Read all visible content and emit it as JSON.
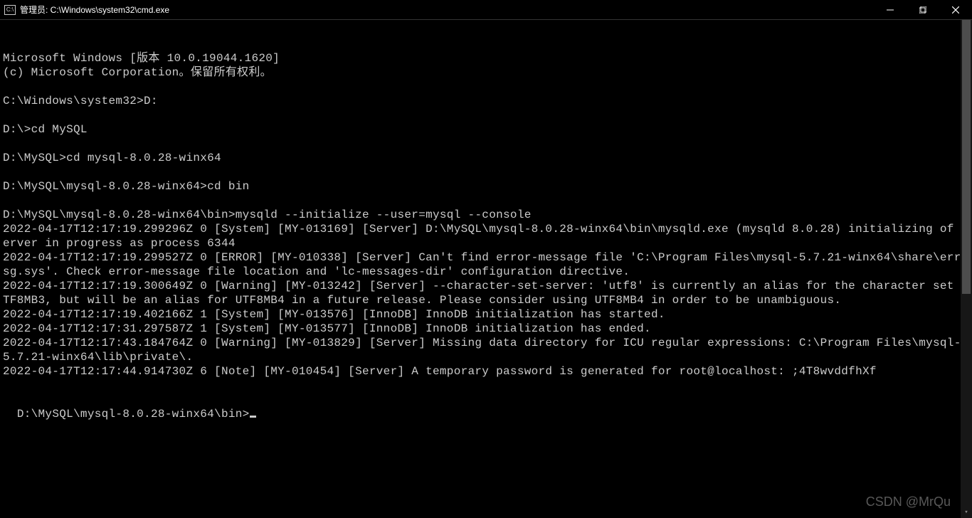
{
  "window": {
    "title": "管理员: C:\\Windows\\system32\\cmd.exe",
    "icon_label": "C:\\"
  },
  "terminal": {
    "lines": [
      "Microsoft Windows [版本 10.0.19044.1620]",
      "(c) Microsoft Corporation。保留所有权利。",
      "",
      "C:\\Windows\\system32>D:",
      "",
      "D:\\>cd MySQL",
      "",
      "D:\\MySQL>cd mysql-8.0.28-winx64",
      "",
      "D:\\MySQL\\mysql-8.0.28-winx64>cd bin",
      "",
      "D:\\MySQL\\mysql-8.0.28-winx64\\bin>mysqld --initialize --user=mysql --console",
      "2022-04-17T12:17:19.299296Z 0 [System] [MY-013169] [Server] D:\\MySQL\\mysql-8.0.28-winx64\\bin\\mysqld.exe (mysqld 8.0.28) initializing of server in progress as process 6344",
      "2022-04-17T12:17:19.299527Z 0 [ERROR] [MY-010338] [Server] Can't find error-message file 'C:\\Program Files\\mysql-5.7.21-winx64\\share\\errmsg.sys'. Check error-message file location and 'lc-messages-dir' configuration directive.",
      "2022-04-17T12:17:19.300649Z 0 [Warning] [MY-013242] [Server] --character-set-server: 'utf8' is currently an alias for the character set UTF8MB3, but will be an alias for UTF8MB4 in a future release. Please consider using UTF8MB4 in order to be unambiguous.",
      "2022-04-17T12:17:19.402166Z 1 [System] [MY-013576] [InnoDB] InnoDB initialization has started.",
      "2022-04-17T12:17:31.297587Z 1 [System] [MY-013577] [InnoDB] InnoDB initialization has ended.",
      "2022-04-17T12:17:43.184764Z 0 [Warning] [MY-013829] [Server] Missing data directory for ICU regular expressions: C:\\Program Files\\mysql-5.7.21-winx64\\lib\\private\\.",
      "2022-04-17T12:17:44.914730Z 6 [Note] [MY-010454] [Server] A temporary password is generated for root@localhost: ;4T8wvddfhXf",
      ""
    ],
    "prompt": "D:\\MySQL\\mysql-8.0.28-winx64\\bin>"
  },
  "watermark": "CSDN @MrQu"
}
